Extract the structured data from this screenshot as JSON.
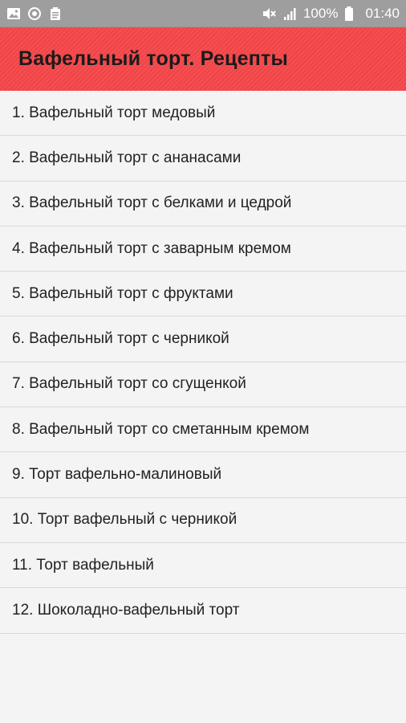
{
  "status_bar": {
    "battery_percent": "100%",
    "time": "01:40",
    "icons_left": [
      "gallery-icon",
      "sync-icon",
      "clipboard-icon"
    ],
    "icons_right": [
      "mute-icon",
      "signal-icon"
    ]
  },
  "app_bar": {
    "title": "Вафельный торт. Рецепты",
    "color": "#f64649"
  },
  "recipes": [
    "1. Вафельный торт медовый",
    "2. Вафельный торт с ананасами",
    "3. Вафельный торт с белками и цедрой",
    "4. Вафельный торт с заварным кремом",
    "5. Вафельный торт с фруктами",
    "6. Вафельный торт с черникой",
    "7. Вафельный торт со сгущенкой",
    "8. Вафельный торт со сметанным кремом",
    "9. Торт вафельно-малиновый",
    "10. Торт вафельный с черникой",
    "11. Торт вафельный",
    "12. Шоколадно-вафельный торт"
  ]
}
